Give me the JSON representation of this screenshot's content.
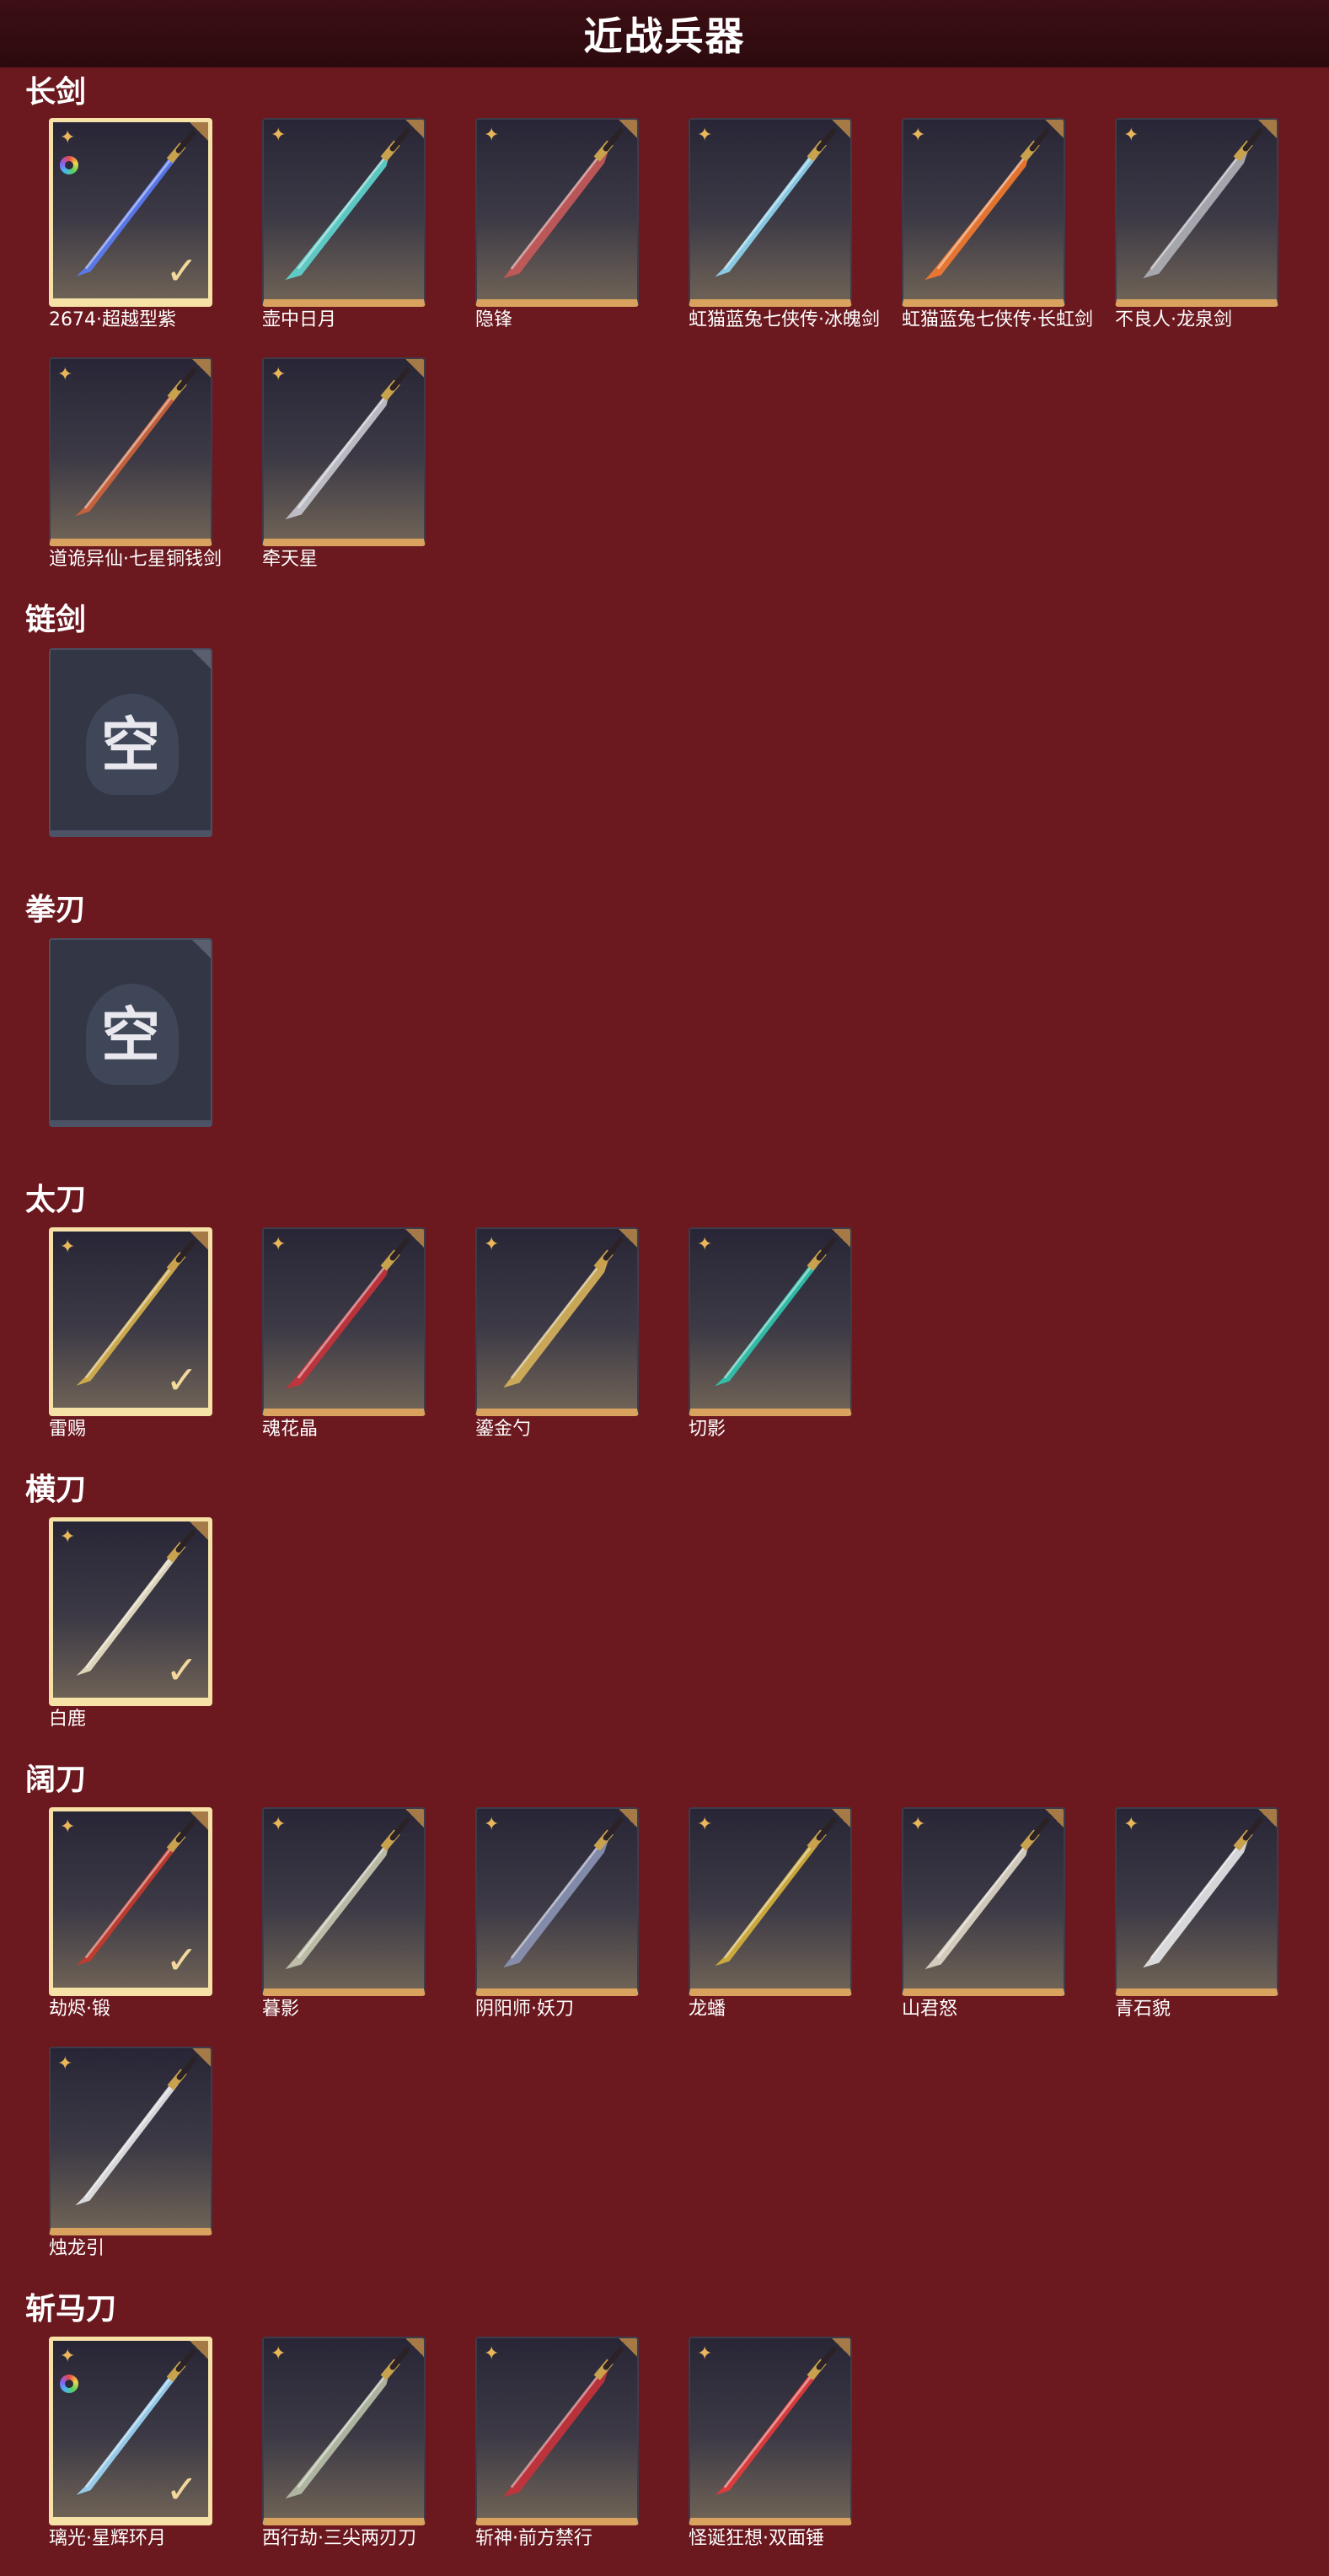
{
  "header": {
    "title": "近战兵器"
  },
  "sections": {
    "s0": {
      "title": "长剑"
    },
    "s1": {
      "title": "链剑"
    },
    "s2": {
      "title": "拳刃"
    },
    "s3": {
      "title": "太刀"
    },
    "s4": {
      "title": "横刀"
    },
    "s5": {
      "title": "阔刀"
    },
    "s6": {
      "title": "斩马刀"
    }
  },
  "items": {
    "changjian": [
      {
        "name": "2674·超越型紫",
        "selected": true,
        "ring": true,
        "color": "#5b7cf7"
      },
      {
        "name": "壶中日月",
        "color": "#5fd6d0"
      },
      {
        "name": "隐锋",
        "color": "#c85a5a"
      },
      {
        "name": "虹猫蓝兔七侠传·冰魄剑",
        "color": "#8fd6f2"
      },
      {
        "name": "虹猫蓝兔七侠传·长虹剑",
        "color": "#f57a2e"
      },
      {
        "name": "不良人·龙泉剑",
        "color": "#b0b0b8"
      },
      {
        "name": "道诡异仙·七星铜钱剑",
        "color": "#d0643a"
      },
      {
        "name": "牵天星",
        "color": "#c8c8d0"
      }
    ],
    "lianjian": {
      "empty_glyph": "空"
    },
    "quanren": {
      "empty_glyph": "空"
    },
    "taidao": [
      {
        "name": "雷赐",
        "selected": true,
        "color": "#d8b24a"
      },
      {
        "name": "魂花晶",
        "color": "#c8323a"
      },
      {
        "name": "鎏金勺",
        "color": "#d7b25a"
      },
      {
        "name": "切影",
        "color": "#2fc8b0"
      }
    ],
    "hengdao": [
      {
        "name": "白鹿",
        "selected": true,
        "color": "#ece3c6"
      }
    ],
    "kuodao": [
      {
        "name": "劫烬·锻",
        "selected": true,
        "color": "#c83a2a"
      },
      {
        "name": "暮影",
        "color": "#c8c8b0"
      },
      {
        "name": "阴阳师·妖刀",
        "color": "#8b93b5"
      },
      {
        "name": "龙蟠",
        "color": "#d8b23a"
      },
      {
        "name": "山君怒",
        "color": "#e0d8c8"
      },
      {
        "name": "青石貌",
        "color": "#e8e8ea"
      },
      {
        "name": "烛龙引",
        "color": "#e8e8ea"
      }
    ],
    "zhanmadao": [
      {
        "name": "璃光·星辉环月",
        "selected": true,
        "ring": true,
        "color": "#9fd8f8"
      },
      {
        "name": "西行劫·三尖两刃刀",
        "color": "#b8c0a8"
      },
      {
        "name": "斩神·前方禁行",
        "color": "#c8323a"
      },
      {
        "name": "怪诞狂想·双面锤",
        "color": "#e83a3a"
      }
    ]
  },
  "icons": {
    "star": "star-icon",
    "check": "check-icon",
    "ring": "color-ring-icon",
    "corner": "corner-tab-icon"
  },
  "colors": {
    "background": "#6b181f",
    "header": "#2c0a0e",
    "card_border": "#d9a25e",
    "selected_border": "#f6e2a6"
  }
}
